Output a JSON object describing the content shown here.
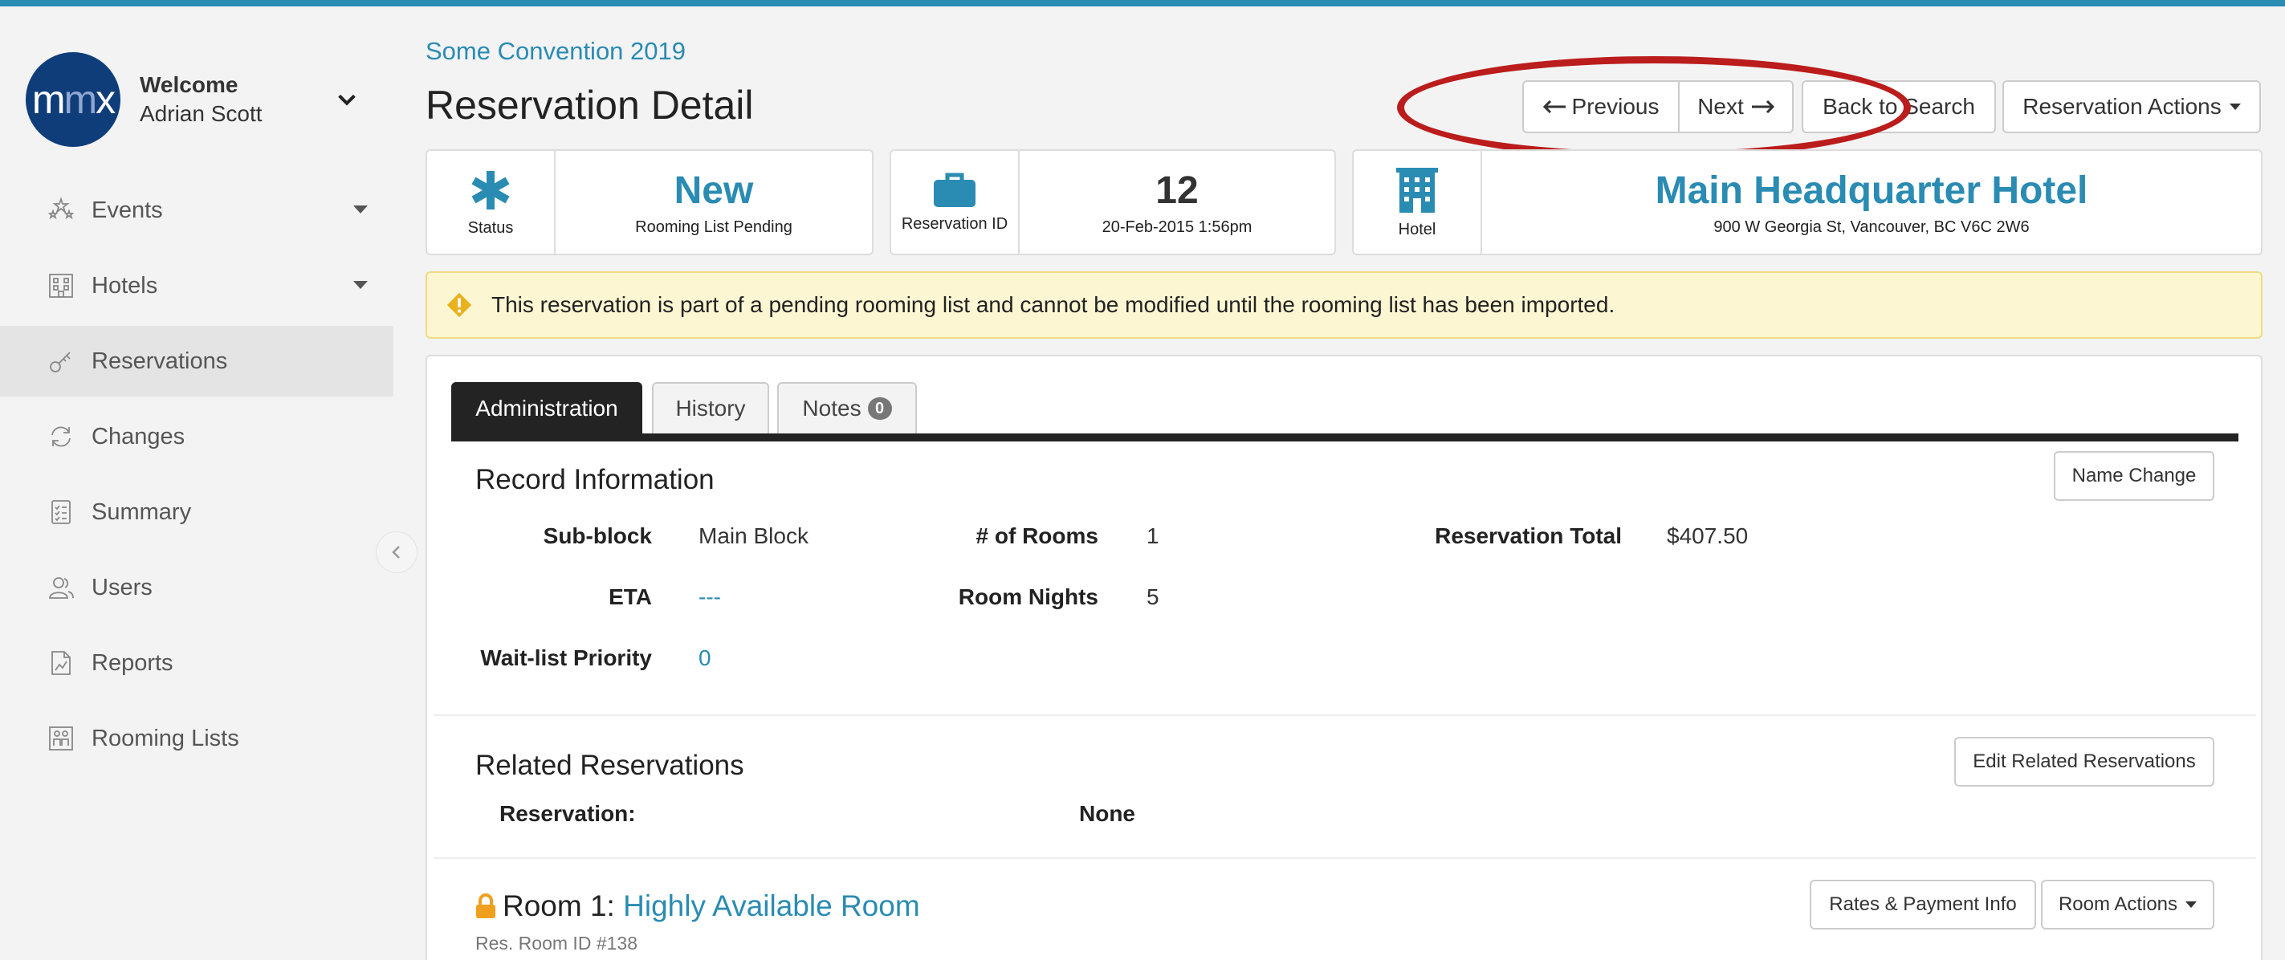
{
  "sidebar": {
    "welcome_title": "Welcome",
    "user_name": "Adrian Scott",
    "logo_text": "mmx",
    "items": [
      {
        "label": "Events",
        "icon": "stars-icon",
        "has_submenu": true
      },
      {
        "label": "Hotels",
        "icon": "building-icon",
        "has_submenu": true
      },
      {
        "label": "Reservations",
        "icon": "key-icon",
        "active": true
      },
      {
        "label": "Changes",
        "icon": "refresh-icon"
      },
      {
        "label": "Summary",
        "icon": "checklist-icon"
      },
      {
        "label": "Users",
        "icon": "users-icon"
      },
      {
        "label": "Reports",
        "icon": "chart-document-icon"
      },
      {
        "label": "Rooming Lists",
        "icon": "rooming-list-icon"
      }
    ]
  },
  "header": {
    "breadcrumb": "Some Convention 2019",
    "title": "Reservation Detail",
    "prev_label": "Previous",
    "next_label": "Next",
    "back_label": "Back to Search",
    "actions_label": "Reservation Actions"
  },
  "cards": {
    "status": {
      "icon_label": "Status",
      "value": "New",
      "sub": "Rooming List Pending"
    },
    "reservation": {
      "icon_label": "Reservation ID",
      "value": "12",
      "sub": "20-Feb-2015 1:56pm"
    },
    "hotel": {
      "icon_label": "Hotel",
      "value": "Main Headquarter Hotel",
      "sub": "900 W Georgia St, Vancouver, BC V6C 2W6"
    }
  },
  "alert": {
    "text": "This reservation is part of a pending rooming list and cannot be modified until the rooming list has been imported."
  },
  "tabs": [
    {
      "label": "Administration",
      "active": true
    },
    {
      "label": "History"
    },
    {
      "label": "Notes",
      "badge": "0"
    }
  ],
  "record": {
    "title": "Record Information",
    "name_change_label": "Name Change",
    "fields": {
      "subblock_label": "Sub-block",
      "subblock_value": "Main Block",
      "rooms_label": "# of Rooms",
      "rooms_value": "1",
      "total_label": "Reservation Total",
      "total_value": "$407.50",
      "eta_label": "ETA",
      "eta_value": "---",
      "nights_label": "Room Nights",
      "nights_value": "5",
      "waitlist_label": "Wait-list Priority",
      "waitlist_value": "0"
    }
  },
  "related": {
    "title": "Related Reservations",
    "edit_label": "Edit Related Reservations",
    "reservation_label": "Reservation:",
    "reservation_value": "None"
  },
  "room": {
    "prefix": "Room 1:",
    "name": "Highly Available Room",
    "sub": "Res. Room ID #138",
    "rates_label": "Rates & Payment Info",
    "actions_label": "Room Actions"
  },
  "colors": {
    "accent": "#2a8bb3",
    "alert_bg": "#fcf6d2",
    "annotation": "#bb1c1c",
    "dark_tab": "#232323",
    "lock": "#f0a01e"
  }
}
